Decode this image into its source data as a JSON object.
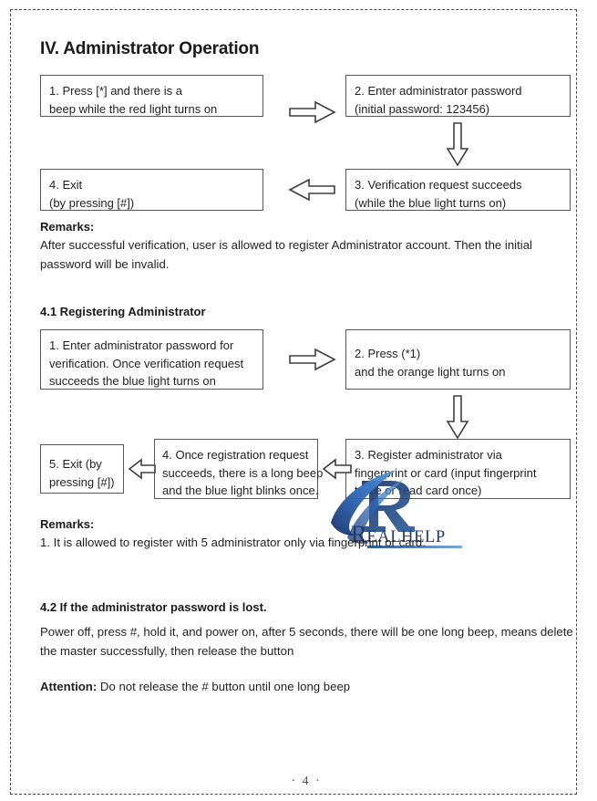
{
  "document": {
    "section_title": "IV. Administrator Operation",
    "page_number": "· 4 ·"
  },
  "flow_admin": {
    "boxes": [
      {
        "id": "step-1",
        "lines": [
          "1. Press [*] and there is a",
          "beep while the red light turns on"
        ]
      },
      {
        "id": "step-2",
        "lines": [
          "2. Enter administrator password",
          "(initial password: 123456)"
        ]
      },
      {
        "id": "step-3",
        "lines": [
          "3. Verification request succeeds",
          "(while the blue light turns on)"
        ]
      },
      {
        "id": "step-4",
        "lines": [
          "4. Exit",
          "(by pressing [#])"
        ]
      }
    ],
    "arrows": [
      {
        "id": "arrow-1-to-2",
        "direction": "right"
      },
      {
        "id": "arrow-2-to-3",
        "direction": "down"
      },
      {
        "id": "arrow-3-to-4",
        "direction": "left"
      }
    ]
  },
  "remarks_1": {
    "label": "Remarks:",
    "text": "After successful verification, user is allowed to register Administrator account. Then the initial password will be invalid."
  },
  "section_41": {
    "heading": "4.1 Registering Administrator",
    "boxes": [
      {
        "id": "step-1",
        "lines": [
          "1. Enter administrator password for",
          "verification. Once verification request",
          "succeeds the blue light turns on"
        ]
      },
      {
        "id": "step-2",
        "lines": [
          "2. Press (*1)",
          "and the orange light turns on"
        ]
      },
      {
        "id": "step-3",
        "lines": [
          "3. Register administrator via",
          "fingerprint or card (input fingerprint",
          "twice or read card once)"
        ]
      },
      {
        "id": "step-4",
        "lines": [
          "4. Once registration request",
          "succeeds, there is a long beep",
          "and the blue light blinks once."
        ]
      },
      {
        "id": "step-5",
        "lines": [
          "5. Exit (by",
          "pressing [#])"
        ]
      }
    ],
    "arrows": [
      {
        "id": "arrow-1-to-2",
        "direction": "right"
      },
      {
        "id": "arrow-2-to-3",
        "direction": "down"
      },
      {
        "id": "arrow-3-to-4",
        "direction": "left"
      },
      {
        "id": "arrow-4-to-5",
        "direction": "left"
      }
    ]
  },
  "remarks_2": {
    "label": "Remarks:",
    "text": "1. It is allowed to register with 5 administrator only via fingerprint or card."
  },
  "section_42": {
    "heading": "4.2 If the administrator password is lost.",
    "body": "Power off, press #, hold it, and power on, after 5 seconds, there will be one long beep, means delete the master successfully, then release the button",
    "attention_label": "Attention:",
    "attention_text": " Do not release the # button until one long beep"
  },
  "watermark": {
    "letter": "R",
    "word": "EALHELP",
    "color_navy": "#1f3a6e",
    "color_blue": "#2b5ea8"
  }
}
